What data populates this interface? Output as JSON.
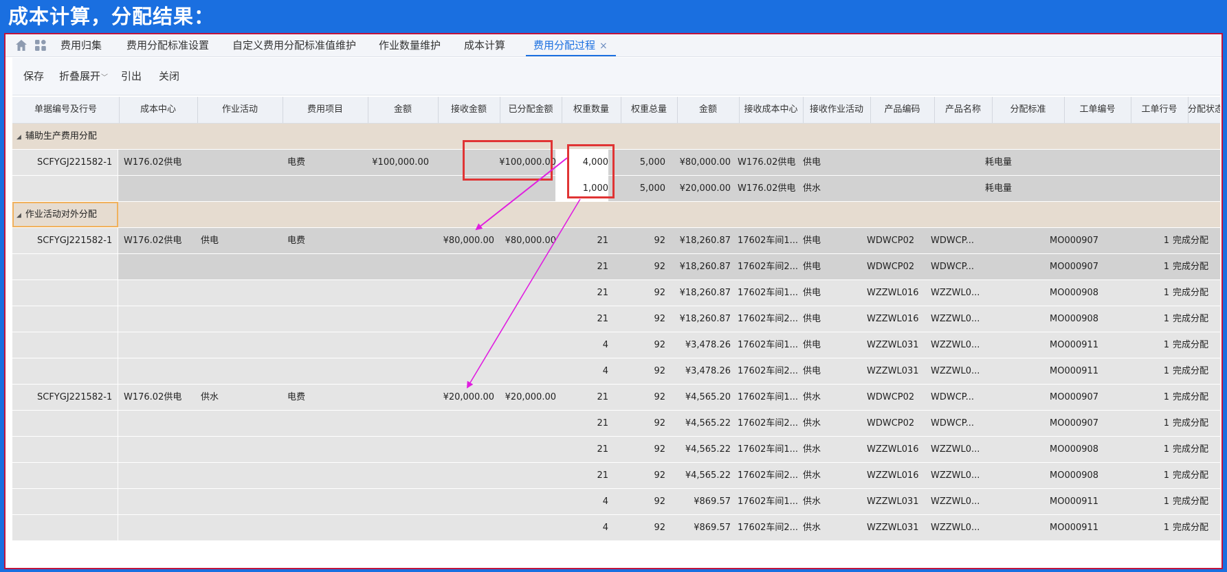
{
  "banner": {
    "title": "成本计算，分配结果："
  },
  "tabs": {
    "home_icon": "home-icon",
    "apps_icon": "apps-icon",
    "items": [
      "费用归集",
      "费用分配标准设置",
      "自定义费用分配标准值维护",
      "作业数量维护",
      "成本计算",
      "费用分配过程"
    ],
    "close_glyph": "×"
  },
  "toolbar": {
    "save": "保存",
    "collapse": "折叠展开",
    "export": "引出",
    "close": "关闭"
  },
  "columns": [
    "单据编号及行号",
    "成本中心",
    "作业活动",
    "费用项目",
    "金额",
    "接收金额",
    "已分配金额",
    "权重数量",
    "权重总量",
    "金额",
    "接收成本中心",
    "接收作业活动",
    "产品编码",
    "产品名称",
    "分配标准",
    "工单编号",
    "工单行号",
    "分配状态"
  ],
  "groups": {
    "g1": "辅助生产费用分配",
    "g2": "作业活动对外分配"
  },
  "rows": {
    "a1": {
      "doc": "SCFYGJ221582-1",
      "center": "W176.02供电",
      "activity": "",
      "item": "电费",
      "amount": "¥100,000.00",
      "recv": "",
      "allocated": "¥100,000.00",
      "wq": "4,000",
      "wt": "5,000",
      "amt": "¥80,000.00",
      "rcenter": "W176.02供电",
      "ract": "供电",
      "pcode": "",
      "pname": "",
      "std": "耗电量",
      "mo": "",
      "moline": "",
      "status": ""
    },
    "a2": {
      "doc": "",
      "center": "",
      "activity": "",
      "item": "",
      "amount": "",
      "recv": "",
      "allocated": "",
      "wq": "1,000",
      "wt": "5,000",
      "amt": "¥20,000.00",
      "rcenter": "W176.02供电",
      "ract": "供水",
      "pcode": "",
      "pname": "",
      "std": "耗电量",
      "mo": "",
      "moline": "",
      "status": ""
    },
    "b1": {
      "doc": "SCFYGJ221582-1",
      "center": "W176.02供电",
      "activity": "供电",
      "item": "电费",
      "amount": "",
      "recv": "¥80,000.00",
      "allocated": "¥80,000.00",
      "wq": "21",
      "wt": "92",
      "amt": "¥18,260.87",
      "rcenter": "17602车间1...",
      "ract": "供电",
      "pcode": "WDWCP02",
      "pname": "WDWCP...",
      "std": "",
      "mo": "MO000907",
      "moline": "1",
      "status": "完成分配"
    },
    "b2": {
      "doc": "",
      "center": "",
      "activity": "",
      "item": "",
      "amount": "",
      "recv": "",
      "allocated": "",
      "wq": "21",
      "wt": "92",
      "amt": "¥18,260.87",
      "rcenter": "17602车间2...",
      "ract": "供电",
      "pcode": "WDWCP02",
      "pname": "WDWCP...",
      "std": "",
      "mo": "MO000907",
      "moline": "1",
      "status": "完成分配"
    },
    "b3": {
      "doc": "",
      "center": "",
      "activity": "",
      "item": "",
      "amount": "",
      "recv": "",
      "allocated": "",
      "wq": "21",
      "wt": "92",
      "amt": "¥18,260.87",
      "rcenter": "17602车间1...",
      "ract": "供电",
      "pcode": "WZZWL016",
      "pname": "WZZWL0...",
      "std": "",
      "mo": "MO000908",
      "moline": "1",
      "status": "完成分配"
    },
    "b4": {
      "doc": "",
      "center": "",
      "activity": "",
      "item": "",
      "amount": "",
      "recv": "",
      "allocated": "",
      "wq": "21",
      "wt": "92",
      "amt": "¥18,260.87",
      "rcenter": "17602车间2...",
      "ract": "供电",
      "pcode": "WZZWL016",
      "pname": "WZZWL0...",
      "std": "",
      "mo": "MO000908",
      "moline": "1",
      "status": "完成分配"
    },
    "b5": {
      "doc": "",
      "center": "",
      "activity": "",
      "item": "",
      "amount": "",
      "recv": "",
      "allocated": "",
      "wq": "4",
      "wt": "92",
      "amt": "¥3,478.26",
      "rcenter": "17602车间1...",
      "ract": "供电",
      "pcode": "WZZWL031",
      "pname": "WZZWL0...",
      "std": "",
      "mo": "MO000911",
      "moline": "1",
      "status": "完成分配"
    },
    "b6": {
      "doc": "",
      "center": "",
      "activity": "",
      "item": "",
      "amount": "",
      "recv": "",
      "allocated": "",
      "wq": "4",
      "wt": "92",
      "amt": "¥3,478.26",
      "rcenter": "17602车间2...",
      "ract": "供电",
      "pcode": "WZZWL031",
      "pname": "WZZWL0...",
      "std": "",
      "mo": "MO000911",
      "moline": "1",
      "status": "完成分配"
    },
    "b7": {
      "doc": "SCFYGJ221582-1",
      "center": "W176.02供电",
      "activity": "供水",
      "item": "电费",
      "amount": "",
      "recv": "¥20,000.00",
      "allocated": "¥20,000.00",
      "wq": "21",
      "wt": "92",
      "amt": "¥4,565.20",
      "rcenter": "17602车间1...",
      "ract": "供水",
      "pcode": "WDWCP02",
      "pname": "WDWCP...",
      "std": "",
      "mo": "MO000907",
      "moline": "1",
      "status": "完成分配"
    },
    "b8": {
      "doc": "",
      "center": "",
      "activity": "",
      "item": "",
      "amount": "",
      "recv": "",
      "allocated": "",
      "wq": "21",
      "wt": "92",
      "amt": "¥4,565.22",
      "rcenter": "17602车间2...",
      "ract": "供水",
      "pcode": "WDWCP02",
      "pname": "WDWCP...",
      "std": "",
      "mo": "MO000907",
      "moline": "1",
      "status": "完成分配"
    },
    "b9": {
      "doc": "",
      "center": "",
      "activity": "",
      "item": "",
      "amount": "",
      "recv": "",
      "allocated": "",
      "wq": "21",
      "wt": "92",
      "amt": "¥4,565.22",
      "rcenter": "17602车间1...",
      "ract": "供水",
      "pcode": "WZZWL016",
      "pname": "WZZWL0...",
      "std": "",
      "mo": "MO000908",
      "moline": "1",
      "status": "完成分配"
    },
    "b10": {
      "doc": "",
      "center": "",
      "activity": "",
      "item": "",
      "amount": "",
      "recv": "",
      "allocated": "",
      "wq": "21",
      "wt": "92",
      "amt": "¥4,565.22",
      "rcenter": "17602车间2...",
      "ract": "供水",
      "pcode": "WZZWL016",
      "pname": "WZZWL0...",
      "std": "",
      "mo": "MO000908",
      "moline": "1",
      "status": "完成分配"
    },
    "b11": {
      "doc": "",
      "center": "",
      "activity": "",
      "item": "",
      "amount": "",
      "recv": "",
      "allocated": "",
      "wq": "4",
      "wt": "92",
      "amt": "¥869.57",
      "rcenter": "17602车间1...",
      "ract": "供水",
      "pcode": "WZZWL031",
      "pname": "WZZWL0...",
      "std": "",
      "mo": "MO000911",
      "moline": "1",
      "status": "完成分配"
    },
    "b12": {
      "doc": "",
      "center": "",
      "activity": "",
      "item": "",
      "amount": "",
      "recv": "",
      "allocated": "",
      "wq": "4",
      "wt": "92",
      "amt": "¥869.57",
      "rcenter": "17602车间2...",
      "ract": "供水",
      "pcode": "WZZWL031",
      "pname": "WZZWL0...",
      "std": "",
      "mo": "MO000911",
      "moline": "1",
      "status": "完成分配"
    }
  },
  "colors": {
    "banner_bg": "#1a6fe0",
    "frame_border": "#c0143c",
    "highlight_box": "#e03434",
    "arrow": "#e01de0",
    "active_tab": "#1a6fe0",
    "group_row": "#e6dcd0"
  }
}
